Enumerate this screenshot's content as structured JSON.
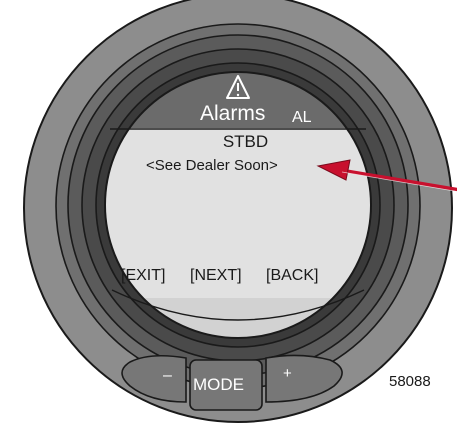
{
  "header": {
    "title": "Alarms",
    "code": "AL",
    "icon": "warning-triangle-icon",
    "color": "#6b6b6b"
  },
  "screen": {
    "engine": "STBD",
    "message": "<See Dealer Soon>",
    "background": "#e0e0e0"
  },
  "softkeys": {
    "exit": "[EXIT]",
    "next": "[NEXT]",
    "back": "[BACK]"
  },
  "buttons": {
    "minus": "–",
    "mode": "MODE",
    "plus": "+"
  },
  "figure": {
    "code": "58088"
  },
  "colors": {
    "bezel_outer": "#8c8c8c",
    "bezel_ring": "#555555",
    "button": "#747474",
    "arrow": "#c8102e"
  }
}
